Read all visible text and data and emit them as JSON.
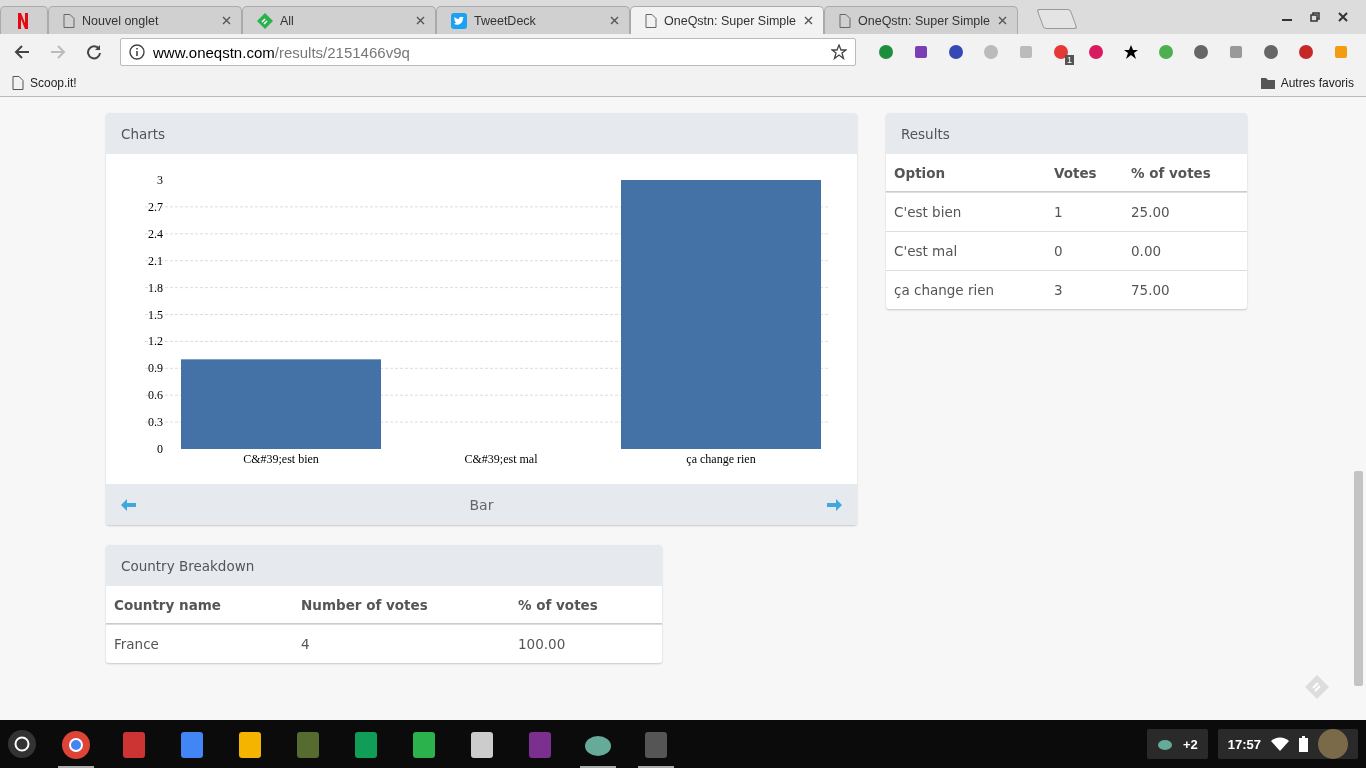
{
  "browser": {
    "tabs": [
      {
        "kind": "pinned",
        "selected": false
      },
      {
        "kind": "page",
        "title": "Nouvel onglet",
        "selected": false
      },
      {
        "kind": "page",
        "title": "All",
        "selected": false
      },
      {
        "kind": "page",
        "title": "TweetDeck",
        "selected": false
      },
      {
        "kind": "page",
        "title": "OneQstn: Super Simple",
        "selected": true
      },
      {
        "kind": "page",
        "title": "OneQstn: Super Simple",
        "selected": false
      }
    ],
    "address": {
      "domain": "www.oneqstn.com",
      "path": "/results/2151466v9q"
    },
    "extension_badge": "1",
    "bookmarks": [
      "Scoop.it!"
    ],
    "other_bookmarks": "Autres favoris"
  },
  "charts_panel": {
    "title": "Charts",
    "switcher_label": "Bar",
    "chart_data": {
      "type": "bar",
      "categories": [
        "C&#39;est bien",
        "C&#39;est mal",
        "ça change rien"
      ],
      "series": [
        {
          "color": "#4472a7",
          "values": [
            1,
            0,
            3
          ]
        }
      ],
      "grid": true,
      "ylim": [
        0,
        3
      ],
      "yticks": [
        0,
        0.3,
        0.6,
        0.9,
        1.2,
        1.5,
        1.8,
        2.1,
        2.4,
        2.7,
        3
      ]
    }
  },
  "results_panel": {
    "title": "Results",
    "columns": [
      "Option",
      "Votes",
      "% of votes"
    ],
    "rows": [
      [
        "C'est bien",
        "1",
        "25.00"
      ],
      [
        "C'est mal",
        "0",
        "0.00"
      ],
      [
        "ça change rien",
        "3",
        "75.00"
      ]
    ]
  },
  "country_panel": {
    "title": "Country Breakdown",
    "columns": [
      "Country name",
      "Number of votes",
      "% of votes"
    ],
    "rows": [
      [
        "France",
        "4",
        "100.00"
      ]
    ]
  },
  "taskbar": {
    "shelf": [
      {
        "running": true
      },
      {
        "running": false
      },
      {
        "running": false
      },
      {
        "running": false
      },
      {
        "running": false
      },
      {
        "running": false
      },
      {
        "running": false
      },
      {
        "running": false
      },
      {
        "running": false
      },
      {
        "running": true
      },
      {
        "running": true
      }
    ],
    "tray_count": "+2",
    "clock": "17:57"
  }
}
